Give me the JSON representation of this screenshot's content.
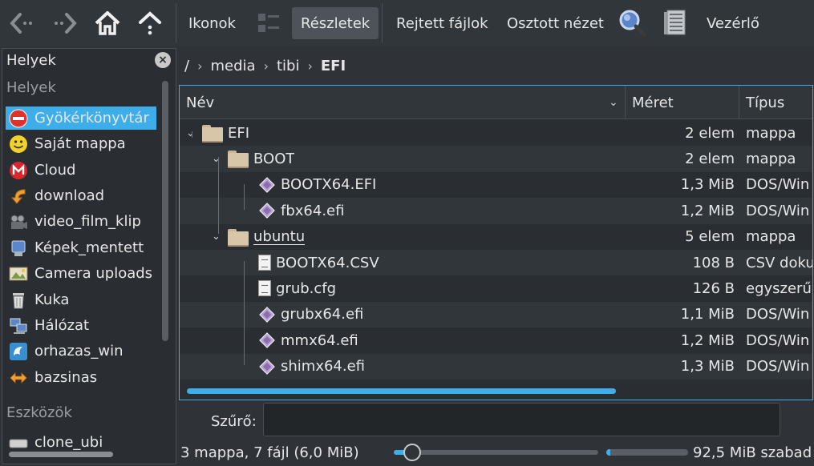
{
  "toolbar": {
    "back_icon": "back-arrow-icon",
    "forward_icon": "forward-arrow-icon",
    "home_icon": "home-icon",
    "up_icon": "up-arrow-icon",
    "icons_label": "Ikonok",
    "compact_icon": "compact-view-icon",
    "details_label": "Részletek",
    "hidden_files_label": "Rejtett fájlok",
    "split_view_label": "Osztott nézet",
    "search_icon": "search-icon",
    "preview_icon": "preview-icon",
    "control_label": "Vezérlő"
  },
  "places": {
    "title": "Helyek",
    "section_places": "Helyek",
    "items": [
      {
        "label": "Gyökérkönyvtár",
        "icon": "root-folder-icon",
        "selected": true
      },
      {
        "label": "Saját mappa",
        "icon": "home-smiley-icon"
      },
      {
        "label": "Cloud",
        "icon": "mega-cloud-icon"
      },
      {
        "label": "download",
        "icon": "download-icon"
      },
      {
        "label": "video_film_klip",
        "icon": "video-icon"
      },
      {
        "label": "Képek_mentett",
        "icon": "pictures-icon"
      },
      {
        "label": "Camera uploads",
        "icon": "camera-uploads-icon"
      },
      {
        "label": "Kuka",
        "icon": "trash-icon"
      },
      {
        "label": "Hálózat",
        "icon": "network-icon"
      },
      {
        "label": "orhazas_win",
        "icon": "share-icon"
      },
      {
        "label": "bazsinas",
        "icon": "link-icon"
      }
    ],
    "section_devices": "Eszközök",
    "devices": [
      {
        "label": "clone_ubi",
        "icon": "drive-icon"
      }
    ]
  },
  "breadcrumb": {
    "items": [
      "/",
      "media",
      "tibi",
      "EFI"
    ]
  },
  "columns": {
    "name": "Név",
    "size": "Méret",
    "type": "Típus"
  },
  "files": [
    {
      "name": "EFI",
      "size": "2 elem",
      "type": "mappa",
      "kind": "folder",
      "level": 0,
      "expanded": true
    },
    {
      "name": "BOOT",
      "size": "2 elem",
      "type": "mappa",
      "kind": "folder",
      "level": 1,
      "expanded": true
    },
    {
      "name": "BOOTX64.EFI",
      "size": "1,3 MiB",
      "type": "DOS/Win",
      "kind": "efi",
      "level": 2
    },
    {
      "name": "fbx64.efi",
      "size": "1,2 MiB",
      "type": "DOS/Win",
      "kind": "efi",
      "level": 2
    },
    {
      "name": "ubuntu",
      "size": "5 elem",
      "type": "mappa",
      "kind": "folder",
      "level": 1,
      "expanded": true
    },
    {
      "name": "BOOTX64.CSV",
      "size": "108 B",
      "type": "CSV doku",
      "kind": "text",
      "level": 2
    },
    {
      "name": "grub.cfg",
      "size": "126 B",
      "type": "egyszerű",
      "kind": "text",
      "level": 2
    },
    {
      "name": "grubx64.efi",
      "size": "1,1 MiB",
      "type": "DOS/Win",
      "kind": "efi",
      "level": 2
    },
    {
      "name": "mmx64.efi",
      "size": "1,2 MiB",
      "type": "DOS/Win",
      "kind": "efi",
      "level": 2
    },
    {
      "name": "shimx64.efi",
      "size": "1,3 MiB",
      "type": "DOS/Win",
      "kind": "efi",
      "level": 2
    }
  ],
  "filter": {
    "label": "Szűrő:",
    "value": ""
  },
  "status": {
    "summary": "3 mappa, 7 fájl (6,0 MiB)",
    "zoom_fraction": 0.09,
    "free_space": "92,5 MiB szabad",
    "used_fraction": 0.05
  },
  "colors": {
    "accent": "#3daee9",
    "background": "#2f3338"
  }
}
